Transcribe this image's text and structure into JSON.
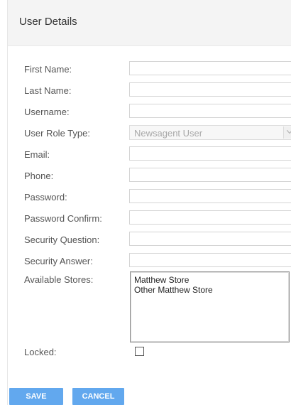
{
  "panel": {
    "title": "User Details"
  },
  "fields": [
    {
      "label": "First Name:",
      "value": ""
    },
    {
      "label": "Last Name:",
      "value": ""
    },
    {
      "label": "Username:",
      "value": ""
    },
    {
      "label": "User Role Type:",
      "value": "Newsagent User"
    },
    {
      "label": "Email:",
      "value": ""
    },
    {
      "label": "Phone:",
      "value": ""
    },
    {
      "label": "Password:",
      "value": ""
    },
    {
      "label": "Password Confirm:",
      "value": ""
    },
    {
      "label": "Security Question:",
      "value": ""
    },
    {
      "label": "Security Answer:",
      "value": ""
    }
  ],
  "stores": {
    "label": "Available Stores:",
    "options": [
      "Matthew Store",
      "Other Matthew Store"
    ]
  },
  "locked": {
    "label": "Locked:",
    "checked": false
  },
  "buttons": {
    "save": "SAVE",
    "cancel": "CANCEL"
  },
  "colors": {
    "button": "#62a8ee",
    "header": "#f4f4f4"
  }
}
